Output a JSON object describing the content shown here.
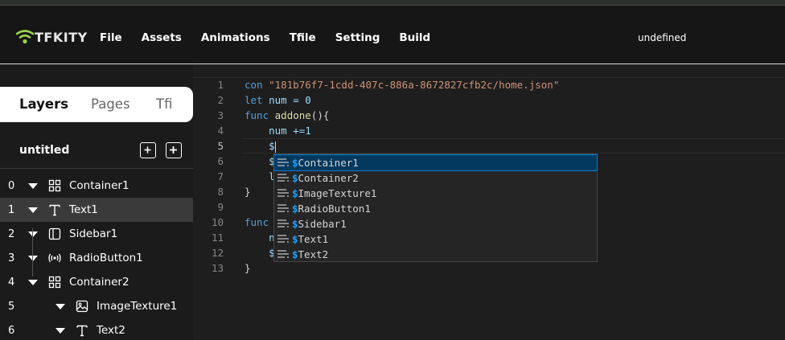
{
  "app": {
    "logo_text": "TFKITY",
    "project_name": "undefined"
  },
  "menu": [
    "File",
    "Assets",
    "Animations",
    "Tfile",
    "Setting",
    "Build"
  ],
  "sidebar": {
    "tabs": [
      "Layers",
      "Pages",
      "Tfi"
    ],
    "active_tab": "Layers",
    "project_title": "untitled",
    "layers": [
      {
        "index": "0",
        "name": "Container1",
        "icon": "grid-icon",
        "depth": 0,
        "selected": false
      },
      {
        "index": "1",
        "name": "Text1",
        "icon": "text-icon",
        "depth": 0,
        "selected": true
      },
      {
        "index": "2",
        "name": "Sidebar1",
        "icon": "sidebar-icon",
        "depth": 0,
        "selected": false
      },
      {
        "index": "3",
        "name": "RadioButton1",
        "icon": "radio-signal-icon",
        "depth": 0,
        "selected": false
      },
      {
        "index": "4",
        "name": "Container2",
        "icon": "grid-icon",
        "depth": 0,
        "selected": false
      },
      {
        "index": "5",
        "name": "ImageTexture1",
        "icon": "image-icon",
        "depth": 1,
        "selected": false
      },
      {
        "index": "6",
        "name": "Text2",
        "icon": "text-icon",
        "depth": 1,
        "selected": false
      }
    ]
  },
  "editor": {
    "line_numbers": [
      "1",
      "2",
      "3",
      "4",
      "5",
      "6",
      "7",
      "8",
      "9",
      "10",
      "11",
      "12",
      "13"
    ],
    "active_line": "5",
    "lines": {
      "l1_kw": "con",
      "l1_str": "\"181b76f7-1cdd-407c-886a-8672827cfb2c/home.json\"",
      "l2_kw": "let",
      "l2_rest": " num = 0",
      "l3_kw": "func",
      "l3_fn": "addone",
      "l3_rest": "(){",
      "l4": "    num +=1",
      "l5": "    $",
      "l6": "    $",
      "l7": "    l",
      "l8": "}",
      "l10_kw": "func",
      "l11": "    n",
      "l12": "    $",
      "l13": "}"
    }
  },
  "autocomplete": {
    "typed": "$",
    "items": [
      "Container1",
      "Container2",
      "ImageTexture1",
      "RadioButton1",
      "Sidebar1",
      "Text1",
      "Text2"
    ],
    "focused_index": 0
  }
}
